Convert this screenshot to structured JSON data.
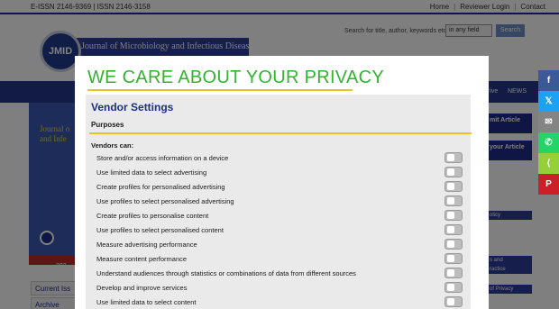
{
  "topbar": {
    "issn": "E-ISSN 2146-9369 | ISSN 2146-3158",
    "links": [
      "Home",
      "Reviewer Login",
      "Contact"
    ]
  },
  "header": {
    "logo_text": "JMID",
    "journal_name": "Journal of Microbiology and Infectious Diseases",
    "search_placeholder": "Search for title, author, keywords etc",
    "field_select": "in any field",
    "search_button": "Search"
  },
  "nav": {
    "items": [
      "rive",
      "NEWS"
    ]
  },
  "hero": {
    "text_line1": "Journal o",
    "text_line2": "and Infe",
    "year": "202"
  },
  "side_links": [
    "Current Iss",
    "Archive"
  ],
  "right_column": {
    "submit_label": "mit Article",
    "track_label": "your Article",
    "list_items": [
      "olicy",
      "s and",
      "ractice",
      "of Privacy"
    ]
  },
  "share": {
    "icons": [
      "facebook-icon",
      "twitter-icon",
      "email-icon",
      "whatsapp-icon",
      "share-icon",
      "pinterest-icon"
    ],
    "glyphs": [
      "f",
      "𝕏",
      "✉",
      "✆",
      "⟨",
      "P"
    ],
    "colors": [
      "#3b5998",
      "#1da1f2",
      "#848484",
      "#25d366",
      "#95d03a",
      "#cb2027"
    ]
  },
  "modal": {
    "title": "WE CARE ABOUT YOUR PRIVACY",
    "section_title": "Vendor Settings",
    "purposes_label": "Purposes",
    "vendors_can_label": "Vendors can:",
    "items": [
      {
        "label": "Store and/or access information on a device",
        "enabled": false
      },
      {
        "label": "Use limited data to select advertising",
        "enabled": false
      },
      {
        "label": "Create profiles for personalised advertising",
        "enabled": false
      },
      {
        "label": "Use profiles to select personalised advertising",
        "enabled": false
      },
      {
        "label": "Create profiles to personalise content",
        "enabled": false
      },
      {
        "label": "Use profiles to select personalised content",
        "enabled": false
      },
      {
        "label": "Measure advertising performance",
        "enabled": false
      },
      {
        "label": "Measure content performance",
        "enabled": false
      },
      {
        "label": "Understand audiences through statistics or combinations of data from different sources",
        "enabled": false
      },
      {
        "label": "Develop and improve services",
        "enabled": false
      },
      {
        "label": "Use limited data to select content",
        "enabled": false
      }
    ]
  }
}
